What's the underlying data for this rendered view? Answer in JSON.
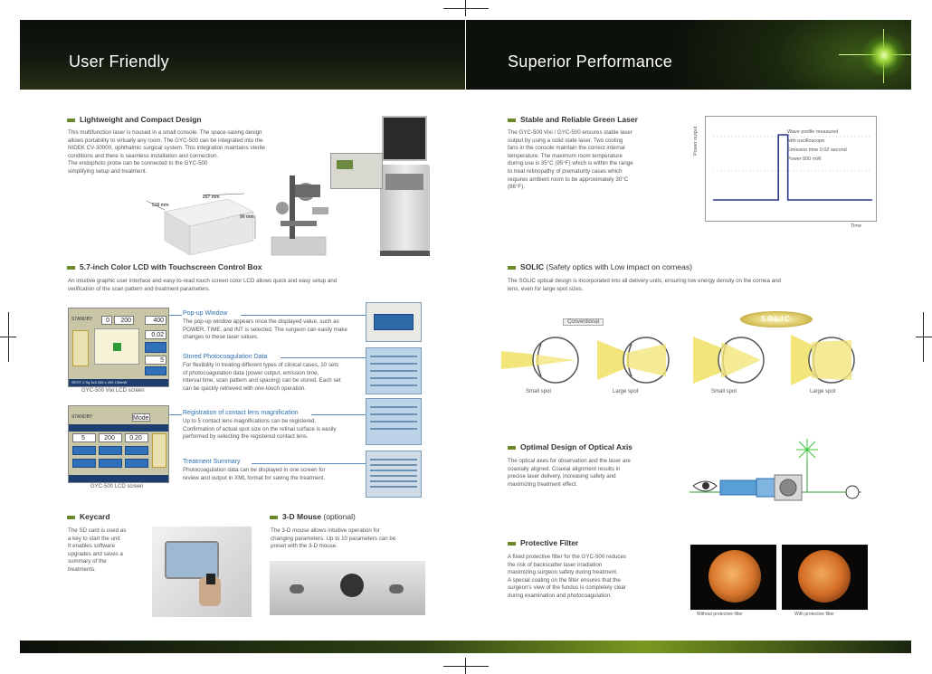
{
  "header": {
    "left_title": "User Friendly",
    "right_title": "Superior Performance"
  },
  "left": {
    "compact": {
      "title": "Lightweight and Compact Design",
      "body": [
        "This multifunction laser is housed in a small console. The space-saving design",
        "allows portability to virtually any room. The GYC-500 can be integrated into the",
        "NIDEK CV-30000, ophthalmic surgical system. This integration maintains sterile",
        "conditions and there is seamless installation and connection.",
        "The endophoto probe can be connected to the GYC-500",
        "simplifying setup and treatment."
      ],
      "dims": [
        "516 mm",
        "257 mm",
        "90 mm"
      ]
    },
    "lcd": {
      "title": "5.7-inch Color LCD with Touchscreen Control Box",
      "body": [
        "An intuitive graphic user interface and easy-to-read touch screen color LCD allows quick and easy setup and",
        "verification of the scan pattern and treatment parameters."
      ],
      "screen1": {
        "caption": "GYC-500 Vixi LCD screen",
        "status": "STANDBY",
        "v1": "0",
        "v2": "200",
        "v3": "400",
        "v4": "0.02",
        "v5": "5",
        "footer_text": "SPOT 1  Sq 3x3  200 x 200  100mW"
      },
      "screen2": {
        "caption": "GYC-500 LCD screen",
        "status": "STANDBY",
        "v1": "5",
        "v2": "200",
        "v3": "0.20",
        "top_text": "Mode"
      },
      "features": [
        {
          "title": "Pop-up Window",
          "body": [
            "The pop-up window appears once the displayed value, such as",
            "POWER, TIME, and INT is selected. The surgeon can easily make",
            "changes to these laser values."
          ]
        },
        {
          "title": "Stored Photocoagulation Data",
          "body": [
            "For flexibility in treating different types of clinical cases, 10 sets",
            "of photocoagulation data (power output, emission time,",
            "interval time, scan pattern and spacing) can be stored. Each set",
            "can be quickly retrieved with one-touch operation."
          ]
        },
        {
          "title": "Registration of contact lens magnification",
          "body": [
            "Up to 5 contact lens magnifications can be registered.",
            "Confirmation of actual spot size on the retinal surface is easily",
            "performed by selecting the registered contact lens."
          ]
        },
        {
          "title": "Treatment Summary",
          "body": [
            "Photocoagulation data can be displayed in one screen for",
            "review and output in XML format for saving the treatment."
          ]
        }
      ]
    },
    "keycard": {
      "title": "Keycard",
      "body": [
        "The SD card is used as",
        "a key to start the unit.",
        "It enables software",
        "upgrades and saves a",
        "summary of the",
        "treatments."
      ]
    },
    "mouse": {
      "title": "3-D Mouse",
      "title_sub": "(optional)",
      "body": [
        "The 3-D mouse allows intuitive operation for",
        "changing parameters. Up to 10 parameters can be",
        "preset with the 3-D mouse."
      ]
    }
  },
  "right": {
    "laser": {
      "title": "Stable and Reliable Green Laser",
      "body": [
        "The GYC-500 Vixi / GYC-500 ensures stable laser",
        "output by using a solid state laser. Two cooling",
        "fans in the console maintain the correct internal",
        "temperature. The maximum room temperature",
        "during use is 35°C (95°F) which is within the range",
        "to treat retinopathy of prematurity cases which",
        "requires ambient room to be approximately 30°C",
        "(86°F)."
      ]
    },
    "solic": {
      "title": "SOLIC",
      "title_sub": "(Safety optics with Low impact on corneas)",
      "body": [
        "The SOLIC optical design is incorporated into all delivery units, ensuring low energy density on the cornea and",
        "lens, even for large spot sizes."
      ],
      "conventional_label": "Conventional",
      "solic_label": "SOLIC",
      "spots": [
        "Small spot",
        "Large spot",
        "Small spot",
        "Large spot"
      ]
    },
    "axis": {
      "title": "Optimal Design of Optical Axis",
      "body": [
        "The optical axes for observation and the laser are",
        "coaxially aligned. Coaxial alignment results in",
        "precise laser delivery, increasing safety and",
        "maximizing treatment effect."
      ]
    },
    "filter": {
      "title": "Protective Filter",
      "body": [
        "A fixed protective filter for the GYC-500 reduces",
        "the risk of backscatter laser irradiation",
        "maximizing surgeon safety during treatment.",
        "A special coating on the filter ensures that the",
        "surgeon's view of the fundus is completely clear",
        "during examination and photocoagulation."
      ],
      "captions": [
        "Without protective filter",
        "With protective filter"
      ]
    }
  },
  "chart_data": {
    "type": "line",
    "xlabel": "Time",
    "ylabel": "Power output",
    "annotations": [
      "Wave profile measured",
      "with oscilloscope",
      "Emission time 0.02 second",
      "Power 500 mW"
    ],
    "series": [
      {
        "values": [
          0,
          0,
          1,
          1,
          0,
          0
        ]
      }
    ],
    "x": [
      0,
      0.41,
      0.41,
      0.47,
      0.47,
      1
    ]
  },
  "colors": {
    "accent": "#6a8a2a",
    "blue_text": "#2d6fb0",
    "header_dark": "#0b0f0a",
    "laser_green": "#7ec64a"
  }
}
